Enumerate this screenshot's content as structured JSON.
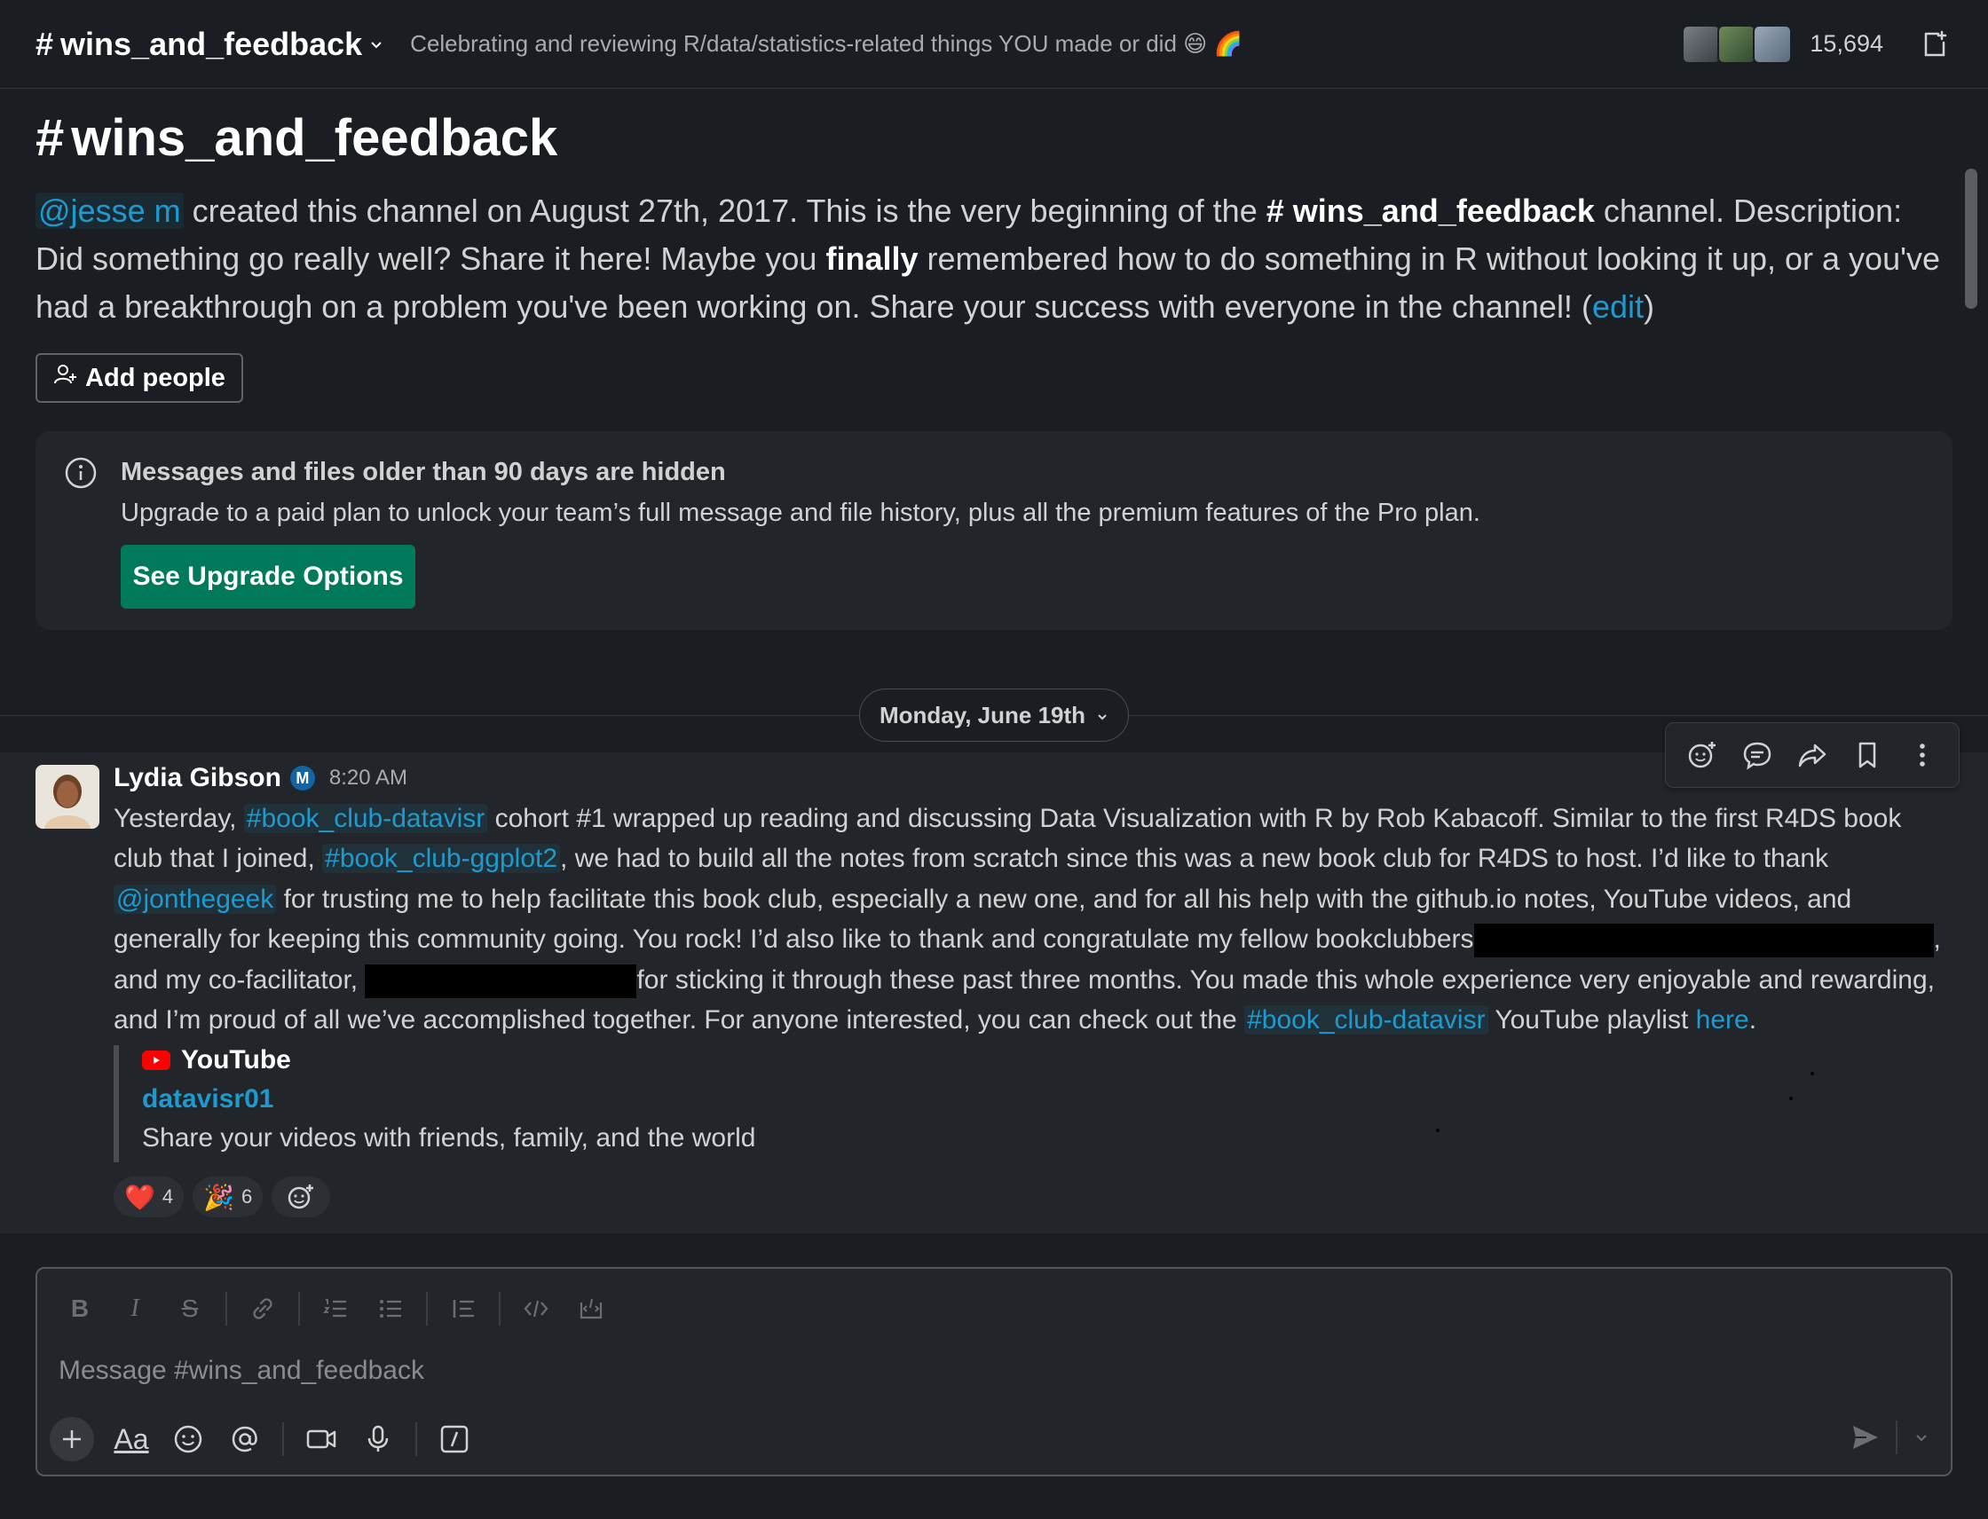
{
  "header": {
    "channel_hash": "#",
    "channel_name": "wins_and_feedback",
    "topic": "Celebrating and reviewing R/data/statistics-related things YOU made or did 😄 🌈",
    "member_count": "15,694"
  },
  "intro": {
    "hash": "#",
    "title": "wins_and_feedback",
    "creator_mention": "@jesse m",
    "text_1": " created this channel on August 27th, 2017. This is the very beginning of the ",
    "channel_ref": "# wins_and_feedback",
    "text_2": " channel. Description: Did something go really well? Share it here! Maybe you ",
    "emphasis": "finally",
    "text_3": " remembered how to do something in R without looking it up, or a you've had a breakthrough on a problem you've been working on. Share your success with everyone in the channel! (",
    "edit_link": "edit",
    "text_4": ")",
    "add_people_label": "Add people"
  },
  "notice": {
    "title": "Messages and files older than 90 days are hidden",
    "body": "Upgrade to a paid plan to unlock your team’s full message and file history, plus all the premium features of the Pro plan.",
    "button": "See Upgrade Options"
  },
  "divider": {
    "date": "Monday, June 19th"
  },
  "message": {
    "author": "Lydia Gibson",
    "badge": "M",
    "time": "8:20 AM",
    "t1": "Yesterday, ",
    "ch1": "#book_club-datavisr",
    "t2": " cohort #1 wrapped up reading and discussing Data Visualization with R by Rob Kabacoff. Similar to the first R4DS book club that I joined, ",
    "ch2": "#book_club-ggplot2",
    "t3": ", we had to build all the notes from scratch since this was a new book club for R4DS to host. I’d like to thank ",
    "mention": "@jonthegeek",
    "t4": " for trusting me to help facilitate this book club, especially a new one, and for all his help with the github.io notes, YouTube videos, and generally for keeping this community going. You rock! I’d also like to thank and congratulate my fellow bookclubbers",
    "t5": ", and my co-facilitator, ",
    "t6": "for sticking it through these past three months. You made this whole experience very enjoyable and rewarding, and I’m proud of all we’ve accomplished together. For anyone interested, you can check out the ",
    "ch3": "#book_club-datavisr",
    "t7": " YouTube playlist ",
    "link": "here",
    "t8": ".",
    "unfurl": {
      "source": "YouTube",
      "title": "datavisr01",
      "description": "Share your videos with friends, family, and the world"
    },
    "reactions": [
      {
        "emoji": "❤️",
        "count": "4"
      },
      {
        "emoji": "🎉",
        "count": "6"
      }
    ]
  },
  "composer": {
    "placeholder": "Message #wins_and_feedback",
    "format_buttons": [
      "B",
      "I",
      "S"
    ],
    "text_style_label": "Aa"
  },
  "colors": {
    "background": "#1a1d21",
    "link": "#1d9bd1",
    "upgrade_button": "#007a5a",
    "panel": "#222529"
  }
}
